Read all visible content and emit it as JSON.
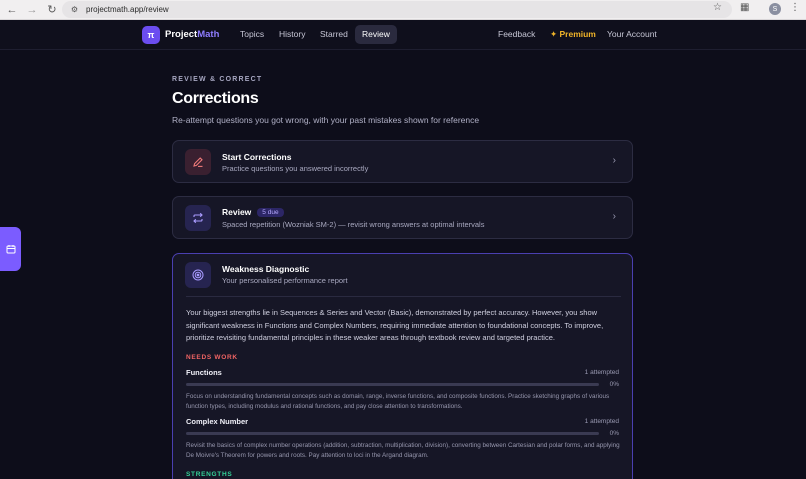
{
  "browser": {
    "url": "projectmath.app/review",
    "profile_initial": "S"
  },
  "nav": {
    "logo_glyph": "π",
    "brand_main": "Project",
    "brand_accent": "Math",
    "links": [
      "Topics",
      "History",
      "Starred",
      "Review"
    ],
    "active": "Review",
    "feedback": "Feedback",
    "premium": "✦ Premium",
    "account": "Your Account"
  },
  "header": {
    "eyebrow": "REVIEW & CORRECT",
    "title": "Corrections",
    "subtitle": "Re-attempt questions you got wrong, with your past mistakes shown for reference"
  },
  "cards": {
    "corrections": {
      "title": "Start Corrections",
      "desc": "Practice questions you answered incorrectly",
      "icon": "pencil-icon"
    },
    "review": {
      "title": "Review",
      "badge": "5 due",
      "desc": "Spaced repetition (Wozniak SM-2) — revisit wrong answers at optimal intervals",
      "icon": "repeat-icon"
    }
  },
  "diagnostic": {
    "title": "Weakness Diagnostic",
    "subtitle": "Your personalised performance report",
    "icon": "target-icon",
    "summary": "Your biggest strengths lie in Sequences & Series and Vector (Basic), demonstrated by perfect accuracy. However, you show significant weakness in Functions and Complex Numbers, requiring immediate attention to foundational concepts. To improve, prioritize revisiting fundamental principles in these weaker areas through textbook review and targeted practice.",
    "needs_work_label": "NEEDS WORK",
    "strengths_label": "STRENGTHS",
    "topics": [
      {
        "name": "Functions",
        "attempted": "1 attempted",
        "percent_label": "0%",
        "percent": 0,
        "note": "Focus on understanding fundamental concepts such as domain, range, inverse functions, and composite functions. Practice sketching graphs of various function types, including modulus and rational functions, and pay close attention to transformations."
      },
      {
        "name": "Complex Number",
        "attempted": "1 attempted",
        "percent_label": "0%",
        "percent": 0,
        "note": "Revisit the basics of complex number operations (addition, subtraction, multiplication, division), converting between Cartesian and polar forms, and applying De Moivre's Theorem for powers and roots. Pay attention to loci in the Argand diagram."
      }
    ]
  },
  "colors": {
    "accent": "#6b4df0",
    "danger": "#f06464",
    "success": "#34d399",
    "premium": "#f0b429"
  }
}
